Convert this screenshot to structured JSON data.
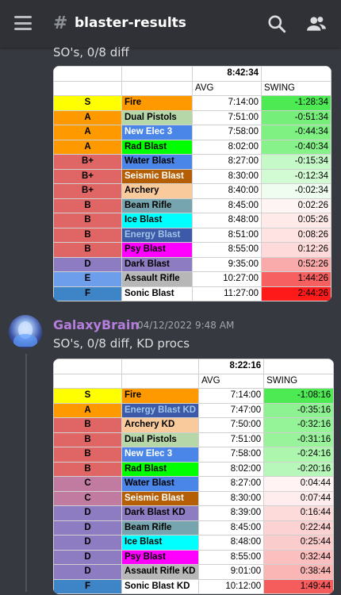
{
  "header": {
    "hash_symbol": "#",
    "channel": "blaster-results"
  },
  "messages": [
    {
      "text": "SO's, 0/8 diff",
      "table": {
        "header_time": "8:42:34",
        "avg_label": "AVG",
        "swing_label": "SWING",
        "rows": [
          {
            "tier": "S",
            "name": "Fire",
            "avg": "7:14:00",
            "swing": "-1:28:34",
            "tier_color": "#ffff00",
            "name_color": "#ff9900",
            "name_text_color": "#000000",
            "swing_color": "#4dea53"
          },
          {
            "tier": "A",
            "name": "Dual Pistols",
            "avg": "7:51:00",
            "swing": "-0:51:34",
            "tier_color": "#ff9900",
            "name_color": "#b6d7a8",
            "name_text_color": "#000000",
            "swing_color": "#75ef7a"
          },
          {
            "tier": "A",
            "name": "New Elec 3",
            "avg": "7:58:00",
            "swing": "-0:44:34",
            "tier_color": "#ff9900",
            "name_color": "#4a86e8",
            "name_text_color": "#ffffff",
            "swing_color": "#7ff183"
          },
          {
            "tier": "A",
            "name": "Rad Blast",
            "avg": "8:02:00",
            "swing": "-0:40:34",
            "tier_color": "#ff9900",
            "name_color": "#00ff00",
            "name_text_color": "#000000",
            "swing_color": "#87f28a"
          },
          {
            "tier": "B+",
            "name": "Water Blast",
            "avg": "8:27:00",
            "swing": "-0:15:34",
            "tier_color": "#e06666",
            "name_color": "#4a86e8",
            "name_text_color": "#000000",
            "swing_color": "#c6f9c8"
          },
          {
            "tier": "B+",
            "name": "Seismic Blast",
            "avg": "8:30:00",
            "swing": "-0:12:34",
            "tier_color": "#e06666",
            "name_color": "#b45f06",
            "name_text_color": "#ffffff",
            "swing_color": "#d2fad3"
          },
          {
            "tier": "B+",
            "name": "Archery",
            "avg": "8:40:00",
            "swing": "-0:02:34",
            "tier_color": "#e06666",
            "name_color": "#f9cb9c",
            "name_text_color": "#000000",
            "swing_color": "#eefdef"
          },
          {
            "tier": "B",
            "name": "Beam Rifle",
            "avg": "8:45:00",
            "swing": "0:02:26",
            "tier_color": "#e06666",
            "name_color": "#76a5af",
            "name_text_color": "#000000",
            "swing_color": "#fff4f4"
          },
          {
            "tier": "B",
            "name": "Ice Blast",
            "avg": "8:48:00",
            "swing": "0:05:26",
            "tier_color": "#e06666",
            "name_color": "#00ffff",
            "name_text_color": "#000000",
            "swing_color": "#ffeaea"
          },
          {
            "tier": "B",
            "name": "Energy Blast",
            "avg": "8:51:00",
            "swing": "0:08:26",
            "tier_color": "#e06666",
            "name_color": "#3c5aa8",
            "name_text_color": "#9fc5e8",
            "swing_color": "#ffe3e3"
          },
          {
            "tier": "B",
            "name": "Psy Blast",
            "avg": "8:55:00",
            "swing": "0:12:26",
            "tier_color": "#e06666",
            "name_color": "#ff00ff",
            "name_text_color": "#000000",
            "swing_color": "#ffdada"
          },
          {
            "tier": "D",
            "name": "Dark Blast",
            "avg": "9:35:00",
            "swing": "0:52:26",
            "tier_color": "#8e7cc3",
            "name_color": "#8e7cc3",
            "name_text_color": "#000000",
            "swing_color": "#f9aaaa"
          },
          {
            "tier": "E",
            "name": "Assault Rifle",
            "avg": "10:27:00",
            "swing": "1:44:26",
            "tier_color": "#6d9eeb",
            "name_color": "#b7b7b7",
            "name_text_color": "#000000",
            "swing_color": "#f76060"
          },
          {
            "tier": "F",
            "name": "Sonic Blast",
            "avg": "11:27:00",
            "swing": "2:44:26",
            "tier_color": "#3d85c6",
            "name_color": "#ffffff",
            "name_text_color": "#000000",
            "swing_color": "#ff1a1a"
          }
        ]
      }
    },
    {
      "author": "GalaxyBrain",
      "timestamp": "04/12/2022 9:48 AM",
      "text": "SO's, 0/8 diff, KD procs",
      "table": {
        "header_time": "8:22:16",
        "avg_label": "AVG",
        "swing_label": "SWING",
        "rows": [
          {
            "tier": "S",
            "name": "Fire",
            "avg": "7:14:00",
            "swing": "-1:08:16",
            "tier_color": "#ffff00",
            "name_color": "#ff9900",
            "name_text_color": "#000000",
            "swing_color": "#4dea53"
          },
          {
            "tier": "A",
            "name": "Energy Blast KD",
            "avg": "7:47:00",
            "swing": "-0:35:16",
            "tier_color": "#ff9900",
            "name_color": "#3c5aa8",
            "name_text_color": "#9fc5e8",
            "swing_color": "#8ff292"
          },
          {
            "tier": "B",
            "name": "Archery KD",
            "avg": "7:50:00",
            "swing": "-0:32:16",
            "tier_color": "#e06666",
            "name_color": "#f9cb9c",
            "name_text_color": "#000000",
            "swing_color": "#95f398"
          },
          {
            "tier": "B",
            "name": "Dual Pistols",
            "avg": "7:51:00",
            "swing": "-0:31:16",
            "tier_color": "#e06666",
            "name_color": "#b6d7a8",
            "name_text_color": "#000000",
            "swing_color": "#98f39b"
          },
          {
            "tier": "B",
            "name": "New Elec 3",
            "avg": "7:58:00",
            "swing": "-0:24:16",
            "tier_color": "#e06666",
            "name_color": "#4a86e8",
            "name_text_color": "#ffffff",
            "swing_color": "#acf6ae"
          },
          {
            "tier": "B",
            "name": "Rad Blast",
            "avg": "8:02:00",
            "swing": "-0:20:16",
            "tier_color": "#e06666",
            "name_color": "#00ff00",
            "name_text_color": "#000000",
            "swing_color": "#b8f7ba"
          },
          {
            "tier": "C",
            "name": "Water Blast",
            "avg": "8:27:00",
            "swing": "0:04:44",
            "tier_color": "#c27ba0",
            "name_color": "#4a86e8",
            "name_text_color": "#000000",
            "swing_color": "#fff3f3"
          },
          {
            "tier": "C",
            "name": "Seismic Blast",
            "avg": "8:30:00",
            "swing": "0:07:44",
            "tier_color": "#c27ba0",
            "name_color": "#b45f06",
            "name_text_color": "#ffffff",
            "swing_color": "#ffecec"
          },
          {
            "tier": "D",
            "name": "Dark Blast KD",
            "avg": "8:39:00",
            "swing": "0:16:44",
            "tier_color": "#8e7cc3",
            "name_color": "#8e7cc3",
            "name_text_color": "#000000",
            "swing_color": "#fddbdb"
          },
          {
            "tier": "D",
            "name": "Beam Rifle",
            "avg": "8:45:00",
            "swing": "0:22:44",
            "tier_color": "#8e7cc3",
            "name_color": "#76a5af",
            "name_text_color": "#000000",
            "swing_color": "#fcd2d2"
          },
          {
            "tier": "D",
            "name": "Ice Blast",
            "avg": "8:48:00",
            "swing": "0:25:44",
            "tier_color": "#8e7cc3",
            "name_color": "#00ffff",
            "name_text_color": "#000000",
            "swing_color": "#fbcccc"
          },
          {
            "tier": "D",
            "name": "Psy Blast",
            "avg": "8:55:00",
            "swing": "0:32:44",
            "tier_color": "#8e7cc3",
            "name_color": "#ff00ff",
            "name_text_color": "#000000",
            "swing_color": "#fbbfbf"
          },
          {
            "tier": "D",
            "name": "Assault Rifle KD",
            "avg": "9:01:00",
            "swing": "0:38:44",
            "tier_color": "#8e7cc3",
            "name_color": "#b7b7b7",
            "name_text_color": "#000000",
            "swing_color": "#fab5b5"
          },
          {
            "tier": "F",
            "name": "Sonic Blast KD",
            "avg": "10:12:00",
            "swing": "1:49:44",
            "tier_color": "#3d85c6",
            "name_color": "#ffffff",
            "name_text_color": "#000000",
            "swing_color": "#f55c5c"
          }
        ]
      }
    }
  ]
}
